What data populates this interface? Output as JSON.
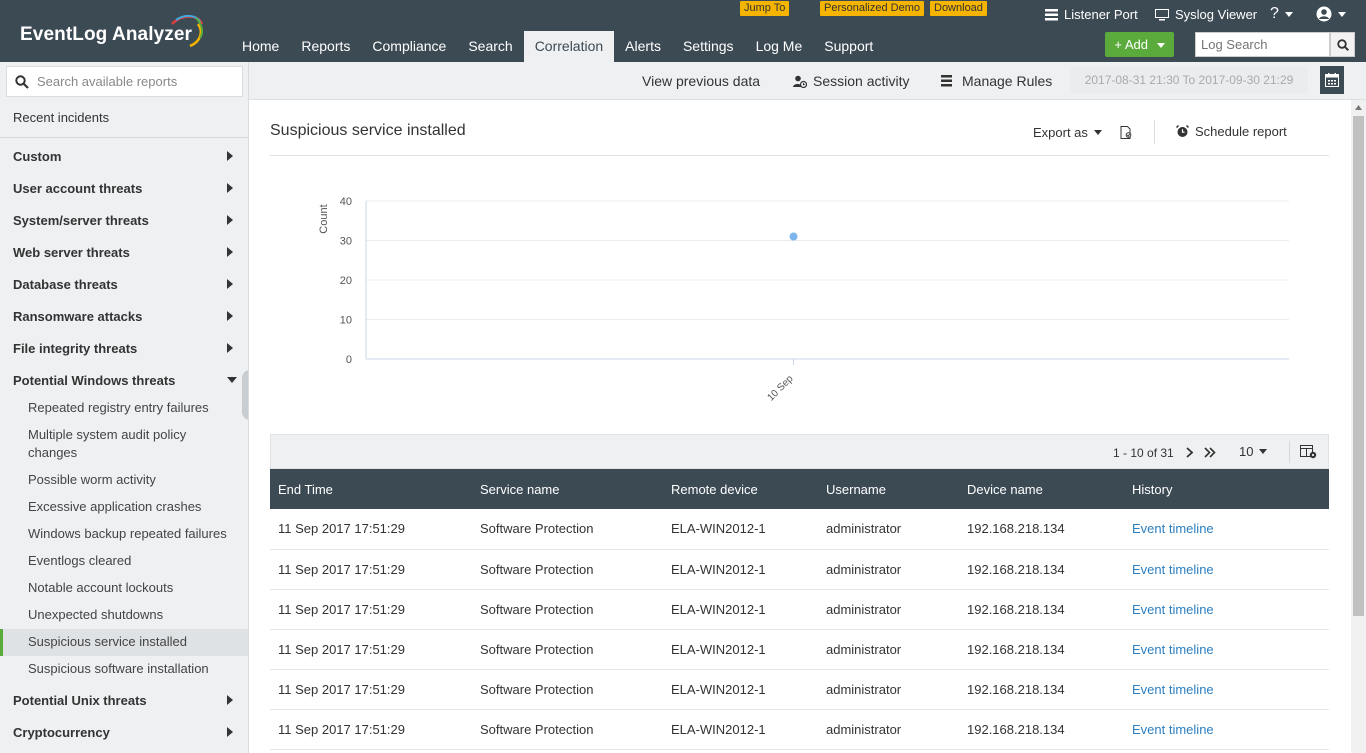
{
  "header": {
    "app_title": "EventLog Analyzer",
    "quick_links": [
      "Jump To",
      "Personalized Demo",
      "Download"
    ],
    "nav": [
      "Home",
      "Reports",
      "Compliance",
      "Search",
      "Correlation",
      "Alerts",
      "Settings",
      "Log Me",
      "Support"
    ],
    "active_nav": "Correlation",
    "listener_port": "Listener Port",
    "syslog_viewer": "Syslog Viewer",
    "help": "?",
    "add_label": "+ Add",
    "log_search_placeholder": "Log Search"
  },
  "subbar": {
    "view_previous": "View previous data",
    "session_activity": "Session activity",
    "manage_rules": "Manage Rules",
    "date_range": "2017-08-31 21:30 To 2017-09-30 21:29"
  },
  "sidebar": {
    "search_placeholder": "Search available reports",
    "recent": "Recent incidents",
    "categories": [
      "Custom",
      "User account threats",
      "System/server threats",
      "Web server threats",
      "Database threats",
      "Ransomware attacks",
      "File integrity threats",
      "Potential Windows threats"
    ],
    "subitems": [
      "Repeated registry entry failures",
      "Multiple system audit policy changes",
      "Possible worm activity",
      "Excessive application crashes",
      "Windows backup repeated failures",
      "Eventlogs cleared",
      "Notable account lockouts",
      "Unexpected shutdowns",
      "Suspicious service installed",
      "Suspicious software installation"
    ],
    "bottom_categories": [
      "Potential Unix threats",
      "Cryptocurrency"
    ]
  },
  "report": {
    "title": "Suspicious service installed",
    "export_label": "Export as",
    "schedule_label": "Schedule report"
  },
  "chart_data": {
    "type": "scatter",
    "title": "",
    "xlabel": "",
    "ylabel": "Count",
    "ylim": [
      0,
      40
    ],
    "yticks": [
      "0",
      "10",
      "20",
      "30",
      "40"
    ],
    "categories": [
      "10 Sep"
    ],
    "values": [
      31
    ],
    "grid": true,
    "point_color": "#7cb5ec"
  },
  "pager": {
    "range": "1 - 10 of 31",
    "per_page": "10"
  },
  "table": {
    "columns": [
      "End Time",
      "Service name",
      "Remote device",
      "Username",
      "Device name",
      "History"
    ],
    "rows": [
      [
        "11 Sep 2017 17:51:29",
        "Software Protection",
        "ELA-WIN2012-1",
        "administrator",
        "192.168.218.134",
        "Event timeline"
      ],
      [
        "11 Sep 2017 17:51:29",
        "Software Protection",
        "ELA-WIN2012-1",
        "administrator",
        "192.168.218.134",
        "Event timeline"
      ],
      [
        "11 Sep 2017 17:51:29",
        "Software Protection",
        "ELA-WIN2012-1",
        "administrator",
        "192.168.218.134",
        "Event timeline"
      ],
      [
        "11 Sep 2017 17:51:29",
        "Software Protection",
        "ELA-WIN2012-1",
        "administrator",
        "192.168.218.134",
        "Event timeline"
      ],
      [
        "11 Sep 2017 17:51:29",
        "Software Protection",
        "ELA-WIN2012-1",
        "administrator",
        "192.168.218.134",
        "Event timeline"
      ],
      [
        "11 Sep 2017 17:51:29",
        "Software Protection",
        "ELA-WIN2012-1",
        "administrator",
        "192.168.218.134",
        "Event timeline"
      ]
    ]
  },
  "colors": {
    "header_bg": "#3c4a54",
    "accent_green": "#5aab3c",
    "quick_link_bg": "#f5b400",
    "link_blue": "#2c7fc0"
  }
}
